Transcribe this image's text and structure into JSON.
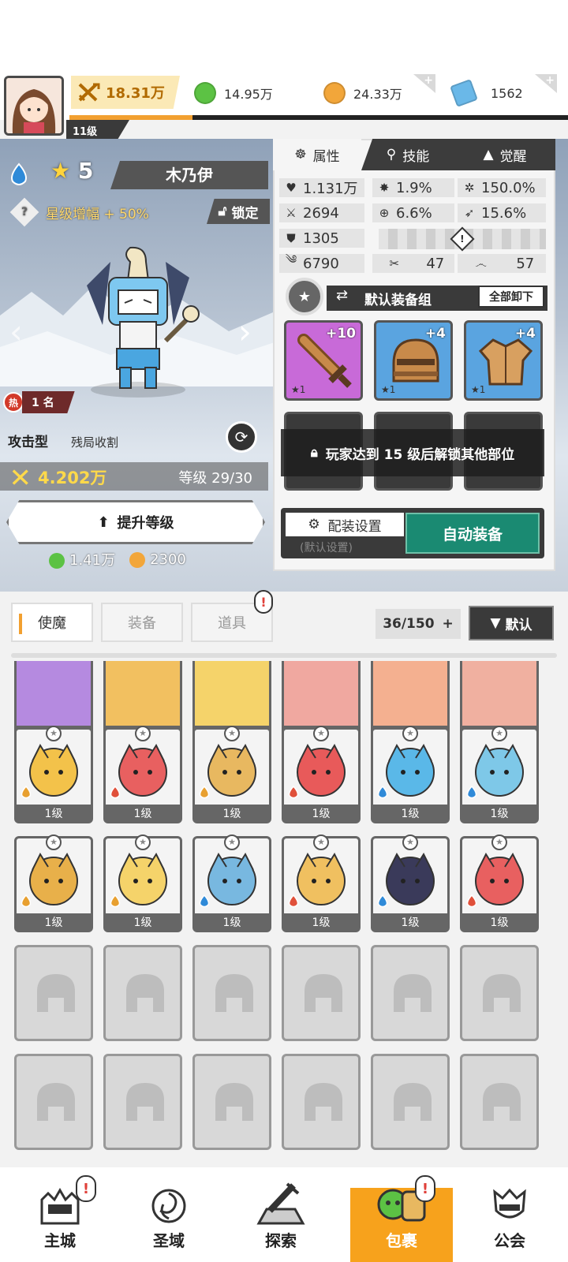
{
  "header": {
    "player_level": "11级",
    "power": "18.31万",
    "currencies": [
      {
        "name": "green-gem",
        "value": "14.95万",
        "color": "#5cc244"
      },
      {
        "name": "gold-coin",
        "value": "24.33万",
        "color": "#f2a63a"
      },
      {
        "name": "crystal",
        "value": "1562",
        "color": "#6ab8e8"
      }
    ],
    "xp_progress": 0.25
  },
  "hero": {
    "element": "water",
    "stars": "5",
    "name": "木乃伊",
    "star_boost": "星级增幅 + 50%",
    "lock_label": "锁定",
    "hot_badge": "热",
    "rank": "1 名",
    "type": "攻击型",
    "skill_tag": "残局收割",
    "combat_power": "4.202万",
    "level_text": "等级 29/30",
    "upgrade_label": "提升等级",
    "cost_green": "1.41万",
    "cost_gold": "2300"
  },
  "panel": {
    "tabs": [
      "属性",
      "技能",
      "觉醒"
    ],
    "stats": [
      {
        "icon": "heart-icon",
        "glyph": "♥",
        "value": "1.131万"
      },
      {
        "icon": "burst-icon",
        "glyph": "✸",
        "value": "1.9%"
      },
      {
        "icon": "gear-burst-icon",
        "glyph": "✲",
        "value": "150.0%"
      },
      {
        "icon": "sword-icon",
        "glyph": "⚔",
        "value": "2694"
      },
      {
        "icon": "crosshair-icon",
        "glyph": "⊕",
        "value": "6.6%"
      },
      {
        "icon": "dodge-icon",
        "glyph": "➶",
        "value": "15.6%"
      },
      {
        "icon": "shield-icon",
        "glyph": "⛊",
        "value": "1305"
      },
      {
        "icon": "wind-icon",
        "glyph": "༄",
        "value": "6790"
      },
      {
        "icon": "slash-icon",
        "glyph": "✂",
        "value": "47"
      },
      {
        "icon": "spiral-icon",
        "glyph": "෴",
        "value": "57"
      }
    ],
    "equip_set_name": "默认装备组",
    "unequip_all": "全部卸下",
    "equipment": [
      {
        "name": "sword",
        "plus": "+10",
        "stars": "★1",
        "bg": "#c86ad8"
      },
      {
        "name": "helmet",
        "plus": "+4",
        "stars": "★1",
        "bg": "#5aa4e0"
      },
      {
        "name": "armor",
        "plus": "+4",
        "stars": "★1",
        "bg": "#5aa4e0"
      }
    ],
    "unlock_message": "玩家达到 15 级后解锁其他部位",
    "config_label": "配装设置",
    "config_sub": "(默认设置)",
    "auto_equip": "自动装备"
  },
  "bag": {
    "tabs": [
      "使魔",
      "装备",
      "道具"
    ],
    "alert": "!",
    "capacity": "36/150",
    "sort_label": "默认",
    "row0_levels": [
      "1级",
      "1级",
      "1级",
      "1级",
      "1级",
      "1级"
    ],
    "rows": [
      [
        {
          "name": "yellow-dragon",
          "level": "1级",
          "element": "earth",
          "color": "#f3c24a"
        },
        {
          "name": "red-dragon",
          "level": "1级",
          "element": "fire",
          "color": "#e86060"
        },
        {
          "name": "bandaged-beast",
          "level": "1级",
          "element": "earth",
          "color": "#e8b860"
        },
        {
          "name": "flower-monster",
          "level": "1级",
          "element": "fire",
          "color": "#e85a5a"
        },
        {
          "name": "blue-urchin",
          "level": "1级",
          "element": "water",
          "color": "#5ab8e8"
        },
        {
          "name": "blue-mummy",
          "level": "1级",
          "element": "water",
          "color": "#7ec8e8"
        }
      ],
      [
        {
          "name": "wood-stump",
          "level": "1级",
          "element": "earth",
          "color": "#e8b04a"
        },
        {
          "name": "horn-girl",
          "level": "1级",
          "element": "earth",
          "color": "#f5d36a"
        },
        {
          "name": "blue-totem",
          "level": "1级",
          "element": "water",
          "color": "#78b8e0"
        },
        {
          "name": "antler-spirit",
          "level": "1级",
          "element": "fire",
          "color": "#f0c060"
        },
        {
          "name": "dark-hair-girl",
          "level": "1级",
          "element": "water",
          "color": "#3a3a5a"
        },
        {
          "name": "white-knight",
          "level": "1级",
          "element": "fire",
          "color": "#e86060"
        }
      ]
    ]
  },
  "nav": [
    {
      "label": "主城",
      "alert": "!"
    },
    {
      "label": "圣域",
      "alert": ""
    },
    {
      "label": "探索",
      "alert": ""
    },
    {
      "label": "包裹",
      "alert": "!"
    },
    {
      "label": "公会",
      "alert": ""
    }
  ]
}
